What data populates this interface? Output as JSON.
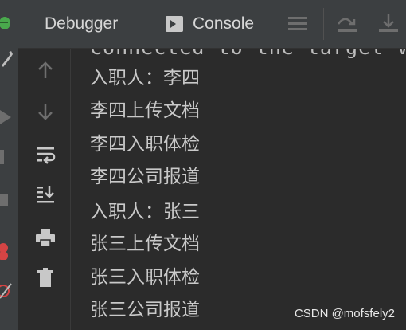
{
  "header": {
    "tabs": [
      {
        "label": "Debugger",
        "active": false
      },
      {
        "label": "Console",
        "active": true
      }
    ]
  },
  "console": {
    "partial_top_line": "Connected to the target V",
    "lines": [
      "入职人：李四",
      "李四上传文档",
      "李四入职体检",
      "李四公司报道",
      "入职人：张三",
      "张三上传文档",
      "张三入职体检",
      "张三公司报道"
    ]
  },
  "watermark": "CSDN @mofsfely2",
  "colors": {
    "background": "#2b2b2b",
    "toolbar": "#3c3f41",
    "text": "#c9c9c9",
    "icon_active": "#c8c8c8",
    "icon_disabled": "#6e6e6e",
    "bug_green": "#49a94c",
    "stop_red": "#d44444"
  }
}
